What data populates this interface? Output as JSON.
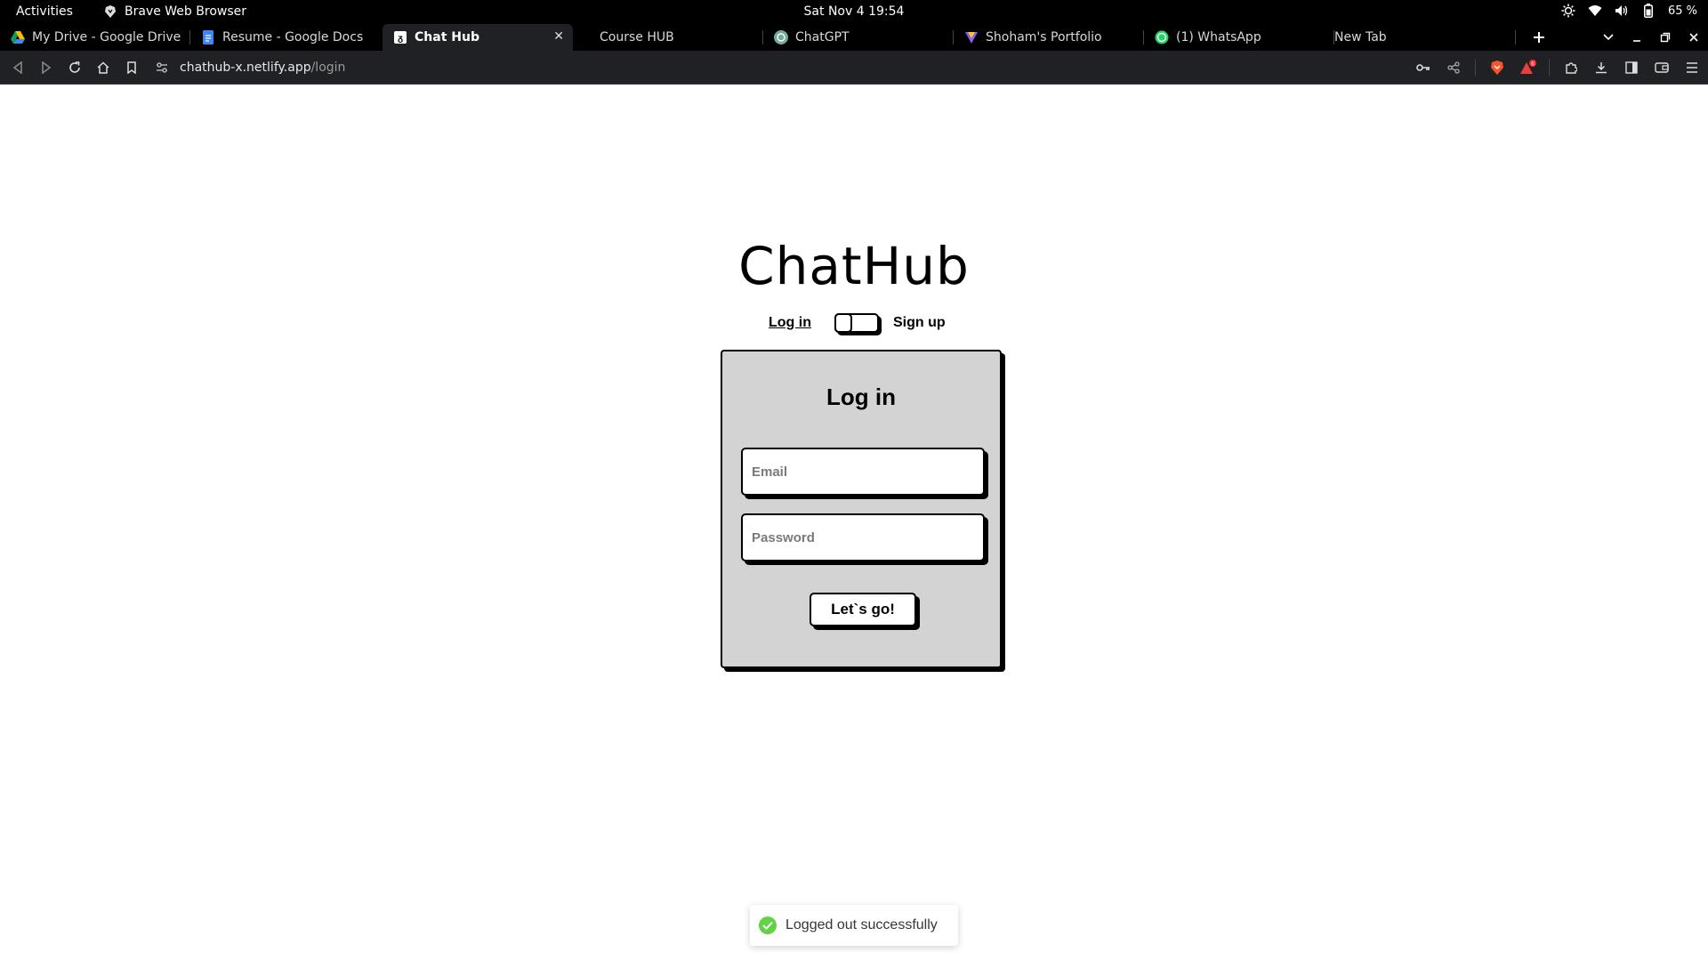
{
  "system_bar": {
    "activities": "Activities",
    "app_name": "Brave Web Browser",
    "datetime": "Sat Nov 4  19:54",
    "battery": "65 %",
    "icons": [
      "brightness-icon",
      "wifi-icon",
      "volume-icon",
      "battery-icon"
    ]
  },
  "tabs": [
    {
      "title": "My Drive - Google Drive",
      "icon": "google-drive-icon"
    },
    {
      "title": "Resume - Google Docs",
      "icon": "google-docs-icon"
    },
    {
      "title": "Chat Hub",
      "icon": "chathub-favicon",
      "active": true
    },
    {
      "title": "Course HUB",
      "icon": ""
    },
    {
      "title": "ChatGPT",
      "icon": "chatgpt-icon"
    },
    {
      "title": "Shoham's Portfolio",
      "icon": "portfolio-icon"
    },
    {
      "title": "(1) WhatsApp",
      "icon": "whatsapp-icon"
    },
    {
      "title": "New Tab",
      "icon": ""
    }
  ],
  "address_bar": {
    "host": "chathub-x.netlify.app",
    "path": "/login"
  },
  "page": {
    "logo": "ChatHub",
    "switch": {
      "login_label": "Log in",
      "signup_label": "Sign up"
    },
    "form": {
      "heading": "Log in",
      "email_placeholder": "Email",
      "password_placeholder": "Password",
      "submit_label": "Let`s go!"
    },
    "toast": {
      "message": "Logged out successfully"
    }
  },
  "colors": {
    "card_bg": "#d3d3d3",
    "toast_success": "#61d345",
    "chrome_bg": "#000000",
    "toolbar_bg": "#202124"
  }
}
